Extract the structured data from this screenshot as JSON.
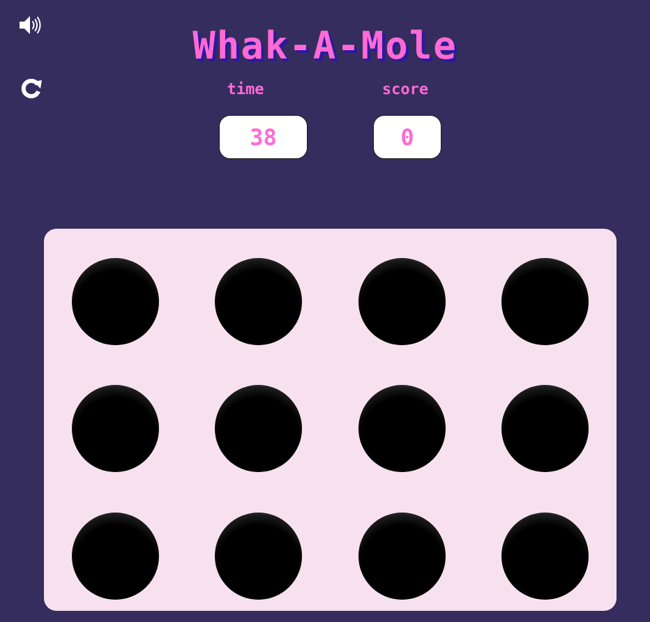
{
  "header": {
    "title": "Whak-A-Mole",
    "sound_icon": "speaker-volume-icon",
    "restart_icon": "restart-icon"
  },
  "stats": {
    "time_label": "time",
    "time_value": "38",
    "score_label": "score",
    "score_value": "0"
  },
  "board": {
    "rows": 3,
    "columns": 4,
    "holes": 12
  },
  "colors": {
    "background": "#352d5e",
    "accent": "#ff6ad5",
    "title_shadow": "#2a1a9e",
    "board": "#f8e1ef",
    "box": "#ffffff",
    "hole": "#000000"
  }
}
